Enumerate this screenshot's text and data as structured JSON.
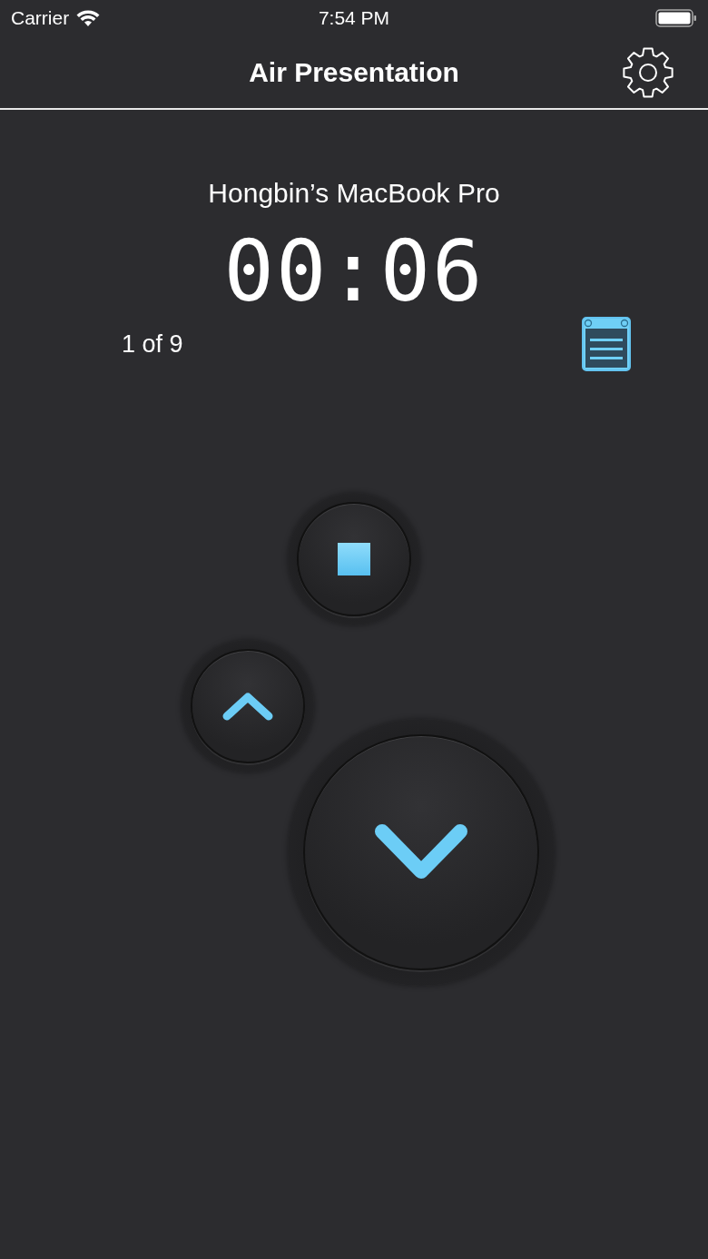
{
  "status_bar": {
    "carrier": "Carrier",
    "time": "7:54 PM"
  },
  "nav_bar": {
    "title": "Air Presentation"
  },
  "device_name": "Hongbin’s MacBook Pro",
  "timer": "00:06",
  "slide_counter": "1 of 9"
}
